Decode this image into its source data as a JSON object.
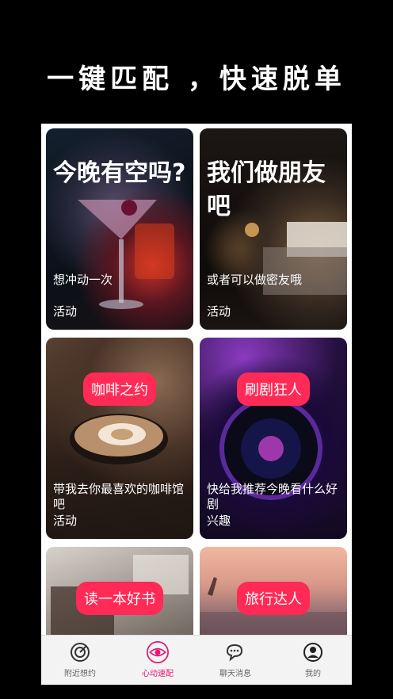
{
  "headline": "一键匹配 ，快速脱单",
  "cards": [
    {
      "title": "今晚有空吗?",
      "desc": "想冲动一次",
      "tag": "活动"
    },
    {
      "title": "我们做朋友吧",
      "desc": "或者可以做密友哦",
      "tag": "活动"
    },
    {
      "pill": "咖啡之约",
      "desc": "带我去你最喜欢的咖啡馆吧",
      "tag": "活动"
    },
    {
      "pill": "刷剧狂人",
      "desc": "快给我推荐今晚看什么好剧",
      "tag": "兴趣"
    },
    {
      "pill": "读一本好书"
    },
    {
      "pill": "旅行达人"
    }
  ],
  "tabs": [
    {
      "label": "附近想约",
      "icon": "compass-icon"
    },
    {
      "label": "心动速配",
      "icon": "eye-icon"
    },
    {
      "label": "聊天消息",
      "icon": "chat-bubbles-icon"
    },
    {
      "label": "我的",
      "icon": "user-icon"
    }
  ],
  "colors": {
    "accent": "#ff2a55",
    "active_tab": "#e21a74"
  }
}
